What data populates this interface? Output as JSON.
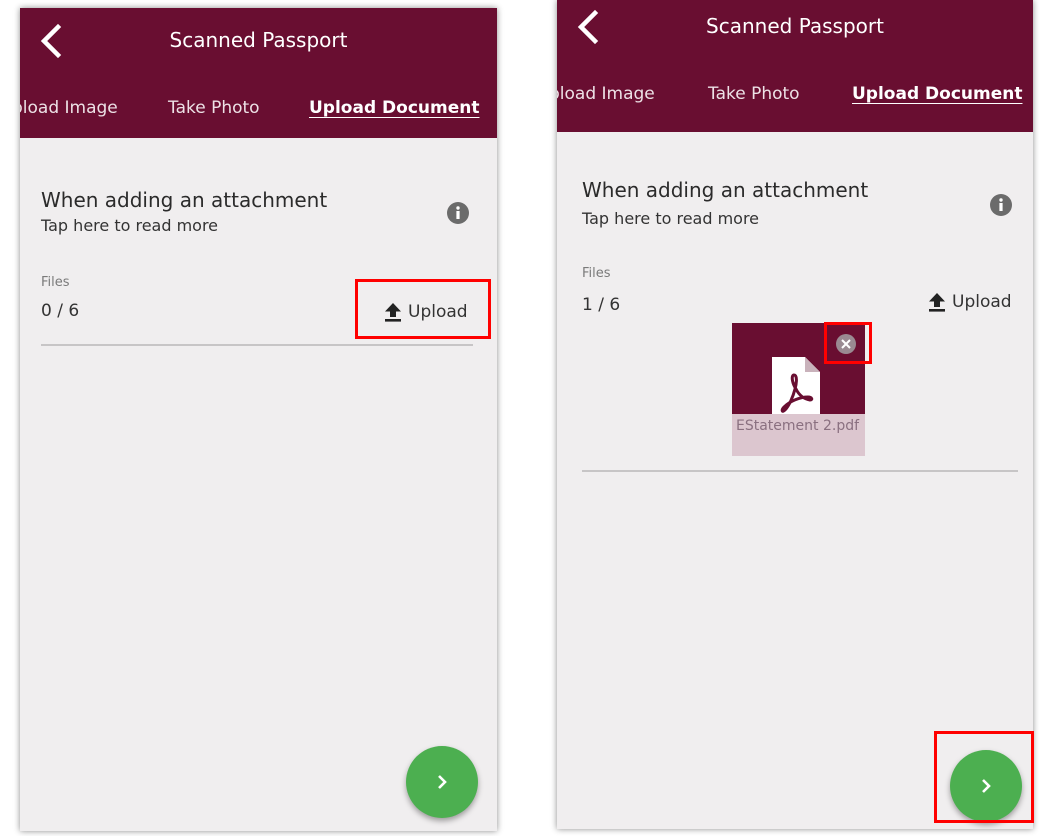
{
  "colors": {
    "appbar": "#690e31",
    "background": "#f0eeef",
    "fab": "#4caf50",
    "highlight": "#ff0000",
    "file_label_bg": "#dcc6cf"
  },
  "left_screen": {
    "header": {
      "title": "Scanned Passport",
      "back_icon": "chevron-left-icon"
    },
    "tabs": [
      {
        "label": "pload Image",
        "active": false
      },
      {
        "label": "Take Photo",
        "active": false
      },
      {
        "label": "Upload Document",
        "active": true
      }
    ],
    "attachment": {
      "heading": "When adding an attachment",
      "subtext": "Tap here to read more",
      "info_icon": "info-icon"
    },
    "files": {
      "label": "Files",
      "count": "0 / 6",
      "upload_label": "Upload",
      "upload_icon": "upload-icon"
    },
    "next_icon": "chevron-right-icon"
  },
  "right_screen": {
    "header": {
      "title": "Scanned Passport",
      "back_icon": "chevron-left-icon"
    },
    "tabs": [
      {
        "label": "pload Image",
        "active": false
      },
      {
        "label": "Take Photo",
        "active": false
      },
      {
        "label": "Upload Document",
        "active": true
      }
    ],
    "attachment": {
      "heading": "When adding an attachment",
      "subtext": "Tap here to read more",
      "info_icon": "info-icon"
    },
    "files": {
      "label": "Files",
      "count": "1 / 6",
      "upload_label": "Upload",
      "upload_icon": "upload-icon"
    },
    "uploaded_files": [
      {
        "name": "EStatement 2.pdf",
        "icon": "pdf-icon",
        "remove_icon": "close-icon"
      }
    ],
    "next_icon": "chevron-right-icon"
  }
}
